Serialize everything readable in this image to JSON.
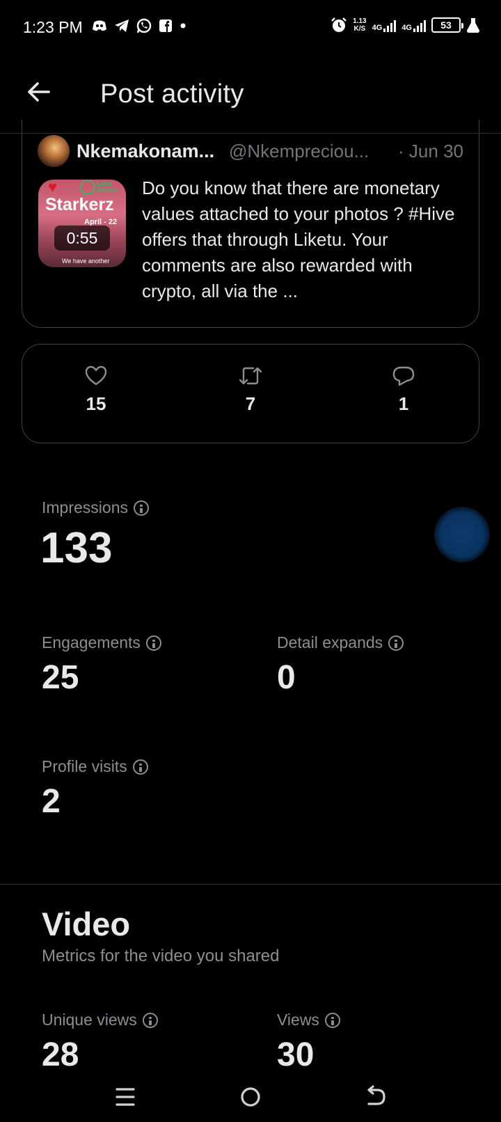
{
  "status_bar": {
    "time": "1:23 PM",
    "app_icons": [
      "discord-icon",
      "telegram-icon",
      "whatsapp-icon",
      "facebook-icon",
      "notification-dot-icon"
    ],
    "speed_value": "1.13",
    "speed_unit": "K/S",
    "network_1": "4G",
    "network_2": "4G",
    "battery": "53"
  },
  "header": {
    "title": "Post activity"
  },
  "post": {
    "author_name": "Nkemakonam...",
    "author_handle": "@Nkempreciou...",
    "date": "· Jun 30",
    "video_duration": "0:55",
    "thumbnail_text": "Starkerz",
    "thumbnail_sub": "April - 22",
    "thumbnail_land": "Land",
    "thumbnail_country": "Mexico",
    "thumbnail_caption": "We have another",
    "text": "Do you know that there are monetary values attached to your photos ? #Hive offers that through Liketu. Your comments are also rewarded with crypto, all via the ..."
  },
  "engagement_stats": {
    "likes": "15",
    "reposts": "7",
    "replies": "1"
  },
  "metrics": {
    "impressions_label": "Impressions",
    "impressions_value": "133",
    "engagements_label": "Engagements",
    "engagements_value": "25",
    "detail_expands_label": "Detail expands",
    "detail_expands_value": "0",
    "profile_visits_label": "Profile visits",
    "profile_visits_value": "2"
  },
  "video_section": {
    "title": "Video",
    "subtitle": "Metrics for the video you shared",
    "unique_views_label": "Unique views",
    "unique_views_value": "28",
    "views_label": "Views",
    "views_value": "30"
  },
  "colors": {
    "background": "#000000",
    "text_primary": "#e7e9ea",
    "text_secondary": "#8b8f94",
    "border": "#3e4144",
    "accent_blue": "#0a3260"
  }
}
